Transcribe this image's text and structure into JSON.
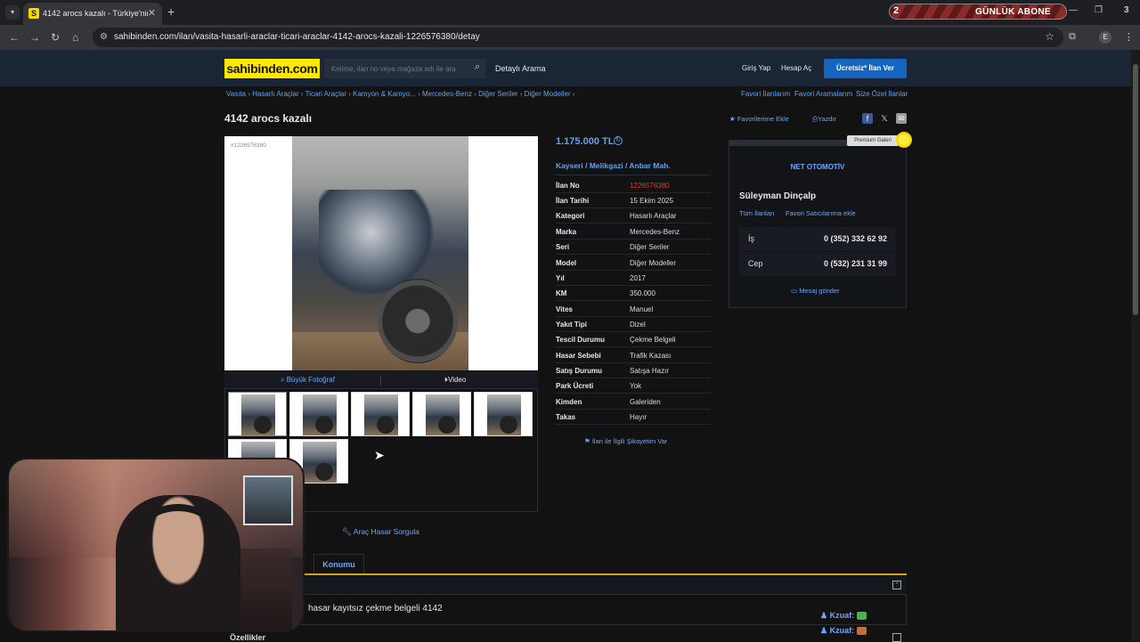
{
  "browser": {
    "tab_title": "4142 arocs kazalı - Türkiye'nin",
    "tab_favicon": "S",
    "url": "sahibinden.com/ilan/vasita-hasarli-araclar-ticari-araclar-4142-arocs-kazali-1226576380/detay",
    "banner_number": "2",
    "banner_text": "GÜNLÜK ABONE",
    "banner_right": "3",
    "profile_letter": "E"
  },
  "header": {
    "logo": "sahibinden.com",
    "search_placeholder": "Kelime, ilan no veya mağaza adı ile ara",
    "detayli": "Detaylı Arama",
    "login": "Giriş Yap",
    "register": "Hesap Aç",
    "post_ad": "Ücretsiz* İlan Ver",
    "accent": "#ffe800"
  },
  "breadcrumb": [
    "Vasıta",
    "Hasarlı Araçlar",
    "Ticari Araçlar",
    "Kamyon & Kamyo...",
    "Mercedes-Benz",
    "Diğer Seriler",
    "Diğer Modeller"
  ],
  "favlinks": [
    "Favori İlanlarım",
    "Favori Aramalarım",
    "Size Özel İlanlar"
  ],
  "listing": {
    "title": "4142 arocs kazalı",
    "add_fav": "Favorilerime Ekle",
    "print": "Yazdır",
    "photo_id": "#1226576380",
    "big_photo": "Büyük Fotoğraf",
    "video": "Video",
    "price": "1.175.000 TL",
    "location": [
      "Kayseri",
      "Melikgazi",
      "Anbar Mah."
    ],
    "details": [
      {
        "k": "İlan No",
        "v": "1226576380"
      },
      {
        "k": "İlan Tarihi",
        "v": "15 Ekim 2025"
      },
      {
        "k": "Kategori",
        "v": "Hasarlı Araçlar"
      },
      {
        "k": "Marka",
        "v": "Mercedes-Benz"
      },
      {
        "k": "Seri",
        "v": "Diğer Seriler"
      },
      {
        "k": "Model",
        "v": "Diğer Modeller"
      },
      {
        "k": "Yıl",
        "v": "2017"
      },
      {
        "k": "KM",
        "v": "350.000"
      },
      {
        "k": "Vites",
        "v": "Manuel"
      },
      {
        "k": "Yakıt Tipi",
        "v": "Dizel"
      },
      {
        "k": "Tescil Durumu",
        "v": "Çekme Belgeli"
      },
      {
        "k": "Hasar Sebebi",
        "v": "Trafik Kazası"
      },
      {
        "k": "Satış Durumu",
        "v": "Satışa Hazır"
      },
      {
        "k": "Park Ücreti",
        "v": "Yok"
      },
      {
        "k": "Kimden",
        "v": "Galeriden"
      },
      {
        "k": "Takas",
        "v": "Hayır"
      }
    ],
    "complaint": "İlan ile İlgili Şikayetim Var",
    "damage_query": "Araç Hasar Sorgula",
    "description": "hasar kayıtsız çekme belgeli 4142",
    "tab_location": "Konumu",
    "features": "Özellikler"
  },
  "seller": {
    "badge": "Premium Galeri",
    "store": "NET OTOMOTİV",
    "name": "Süleyman Dinçalp",
    "all_ads": "Tüm İlanları",
    "fav_seller": "Favori Satıcılarıma ekle",
    "phones": [
      {
        "k": "İş",
        "v": "0 (352) 332 62 92"
      },
      {
        "k": "Cep",
        "v": "0 (532) 231 31 99"
      }
    ],
    "message": "Mesaj gönder"
  },
  "chat": [
    {
      "user": "Kzuaf:",
      "color": "#4caf50"
    },
    {
      "user": "Kzuaf:",
      "color": "#c0703a"
    }
  ]
}
